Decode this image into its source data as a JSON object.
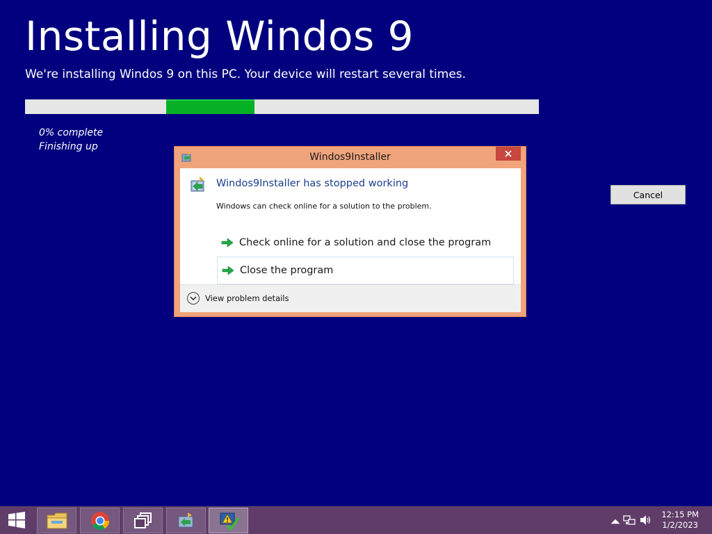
{
  "installer": {
    "title": "Installing Windos 9",
    "subtitle": "We're installing Windos 9 on this PC. Your device will restart several times.",
    "progress_bar": {
      "segment_start_fraction": 0.275,
      "segment_end_fraction": 0.447,
      "fill_color": "#06b025"
    },
    "percent_text": "0% complete",
    "phase_text": "Finishing up",
    "cancel_label": "Cancel",
    "background_color": "#02007e"
  },
  "dialog": {
    "window_title": "Windos9Installer",
    "heading": "Windos9Installer has stopped working",
    "description": "Windows can check online for a solution to the problem.",
    "options": [
      {
        "label": "Check online for a solution and close the program"
      },
      {
        "label": "Close the program"
      }
    ],
    "details_label": "View problem details",
    "frame_color": "#f0a47c",
    "close_icon": "close-icon"
  },
  "taskbar": {
    "color": "#5f3d68",
    "items": [
      {
        "icon": "file-explorer-icon"
      },
      {
        "icon": "chrome-icon"
      },
      {
        "icon": "task-switch-icon"
      },
      {
        "icon": "installer-icon"
      },
      {
        "icon": "error-report-icon"
      }
    ],
    "clock": {
      "time": "12:15 PM",
      "date": "1/2/2023"
    }
  }
}
